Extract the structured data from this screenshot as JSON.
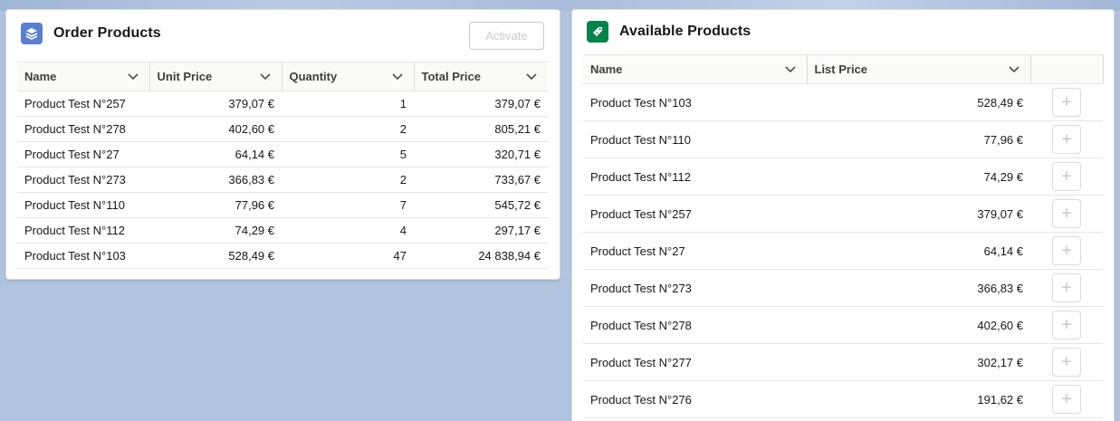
{
  "order_products": {
    "title": "Order Products",
    "icon": "stacked-layers-icon",
    "icon_color": "#5a7fd1",
    "activate_label": "Activate",
    "columns": [
      "Name",
      "Unit Price",
      "Quantity",
      "Total Price"
    ],
    "rows": [
      {
        "name": "Product Test N°257",
        "unit_price": "379,07 €",
        "quantity": "1",
        "total_price": "379,07 €"
      },
      {
        "name": "Product Test N°278",
        "unit_price": "402,60 €",
        "quantity": "2",
        "total_price": "805,21 €"
      },
      {
        "name": "Product Test N°27",
        "unit_price": "64,14 €",
        "quantity": "5",
        "total_price": "320,71 €"
      },
      {
        "name": "Product Test N°273",
        "unit_price": "366,83 €",
        "quantity": "2",
        "total_price": "733,67 €"
      },
      {
        "name": "Product Test N°110",
        "unit_price": "77,96 €",
        "quantity": "7",
        "total_price": "545,72 €"
      },
      {
        "name": "Product Test N°112",
        "unit_price": "74,29 €",
        "quantity": "4",
        "total_price": "297,17 €"
      },
      {
        "name": "Product Test N°103",
        "unit_price": "528,49 €",
        "quantity": "47",
        "total_price": "24 838,94 €"
      }
    ]
  },
  "available_products": {
    "title": "Available Products",
    "icon": "price-tag-icon",
    "icon_color": "#04844b",
    "columns": [
      "Name",
      "List Price"
    ],
    "rows": [
      {
        "name": "Product Test N°103",
        "list_price": "528,49 €"
      },
      {
        "name": "Product Test N°110",
        "list_price": "77,96 €"
      },
      {
        "name": "Product Test N°112",
        "list_price": "74,29 €"
      },
      {
        "name": "Product Test N°257",
        "list_price": "379,07 €"
      },
      {
        "name": "Product Test N°27",
        "list_price": "64,14 €"
      },
      {
        "name": "Product Test N°273",
        "list_price": "366,83 €"
      },
      {
        "name": "Product Test N°278",
        "list_price": "402,60 €"
      },
      {
        "name": "Product Test N°277",
        "list_price": "302,17 €"
      },
      {
        "name": "Product Test N°276",
        "list_price": "191,62 €"
      }
    ],
    "add_icon": "plus-icon"
  }
}
